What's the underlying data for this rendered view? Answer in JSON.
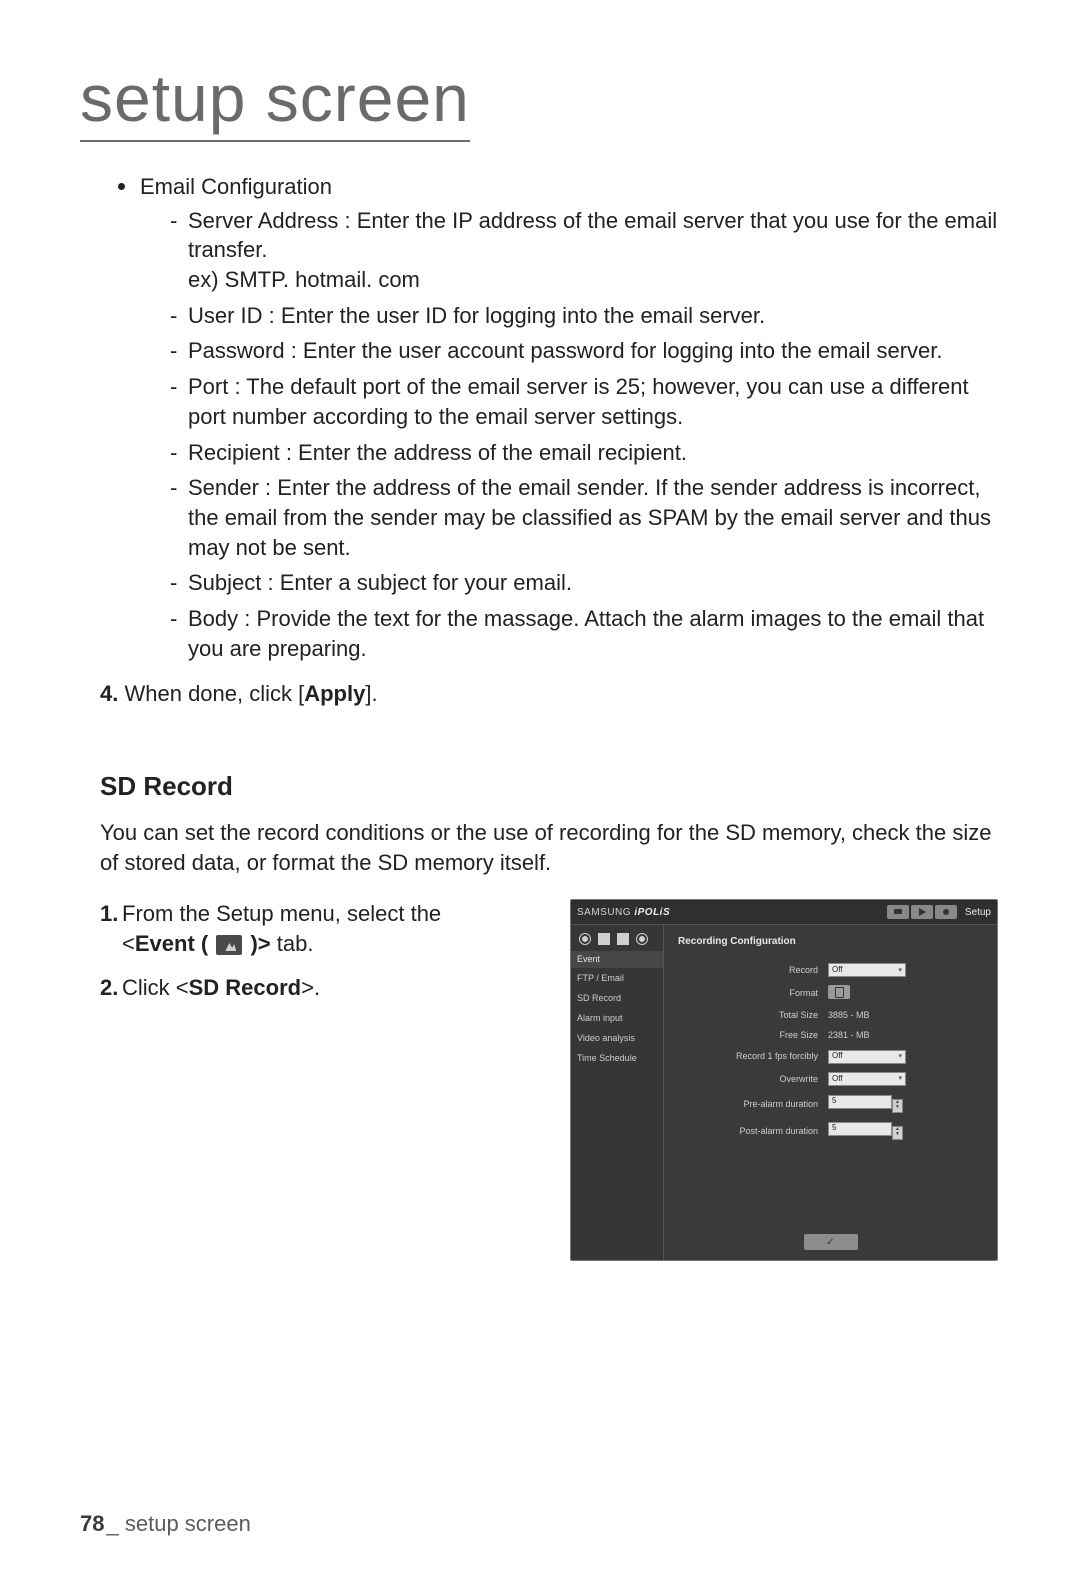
{
  "page": {
    "title": "setup screen",
    "footer_page": "78",
    "footer_sep": "_",
    "footer_label": "setup screen"
  },
  "email_config": {
    "heading": "Email Configuration",
    "items": [
      "Server Address : Enter the IP address of the email server that you use for the email transfer.\nex) SMTP. hotmail. com",
      "User ID : Enter the user ID for logging into the email server.",
      "Password : Enter the user account password for logging into the email server.",
      "Port : The default port of the email server is 25; however, you can use a different port number according to the email server settings.",
      "Recipient : Enter the address of the email recipient.",
      "Sender : Enter the address of the email sender. If the sender address is incorrect, the email from the sender may be classified as SPAM by the email server and thus may not be sent.",
      "Subject : Enter a subject for your email.",
      "Body : Provide the text for the massage. Attach the alarm images to the email that you are preparing."
    ]
  },
  "step4": {
    "num": "4.",
    "text_before": "When done, click [",
    "bold": "Apply",
    "text_after": "]."
  },
  "sd_record": {
    "heading": "SD Record",
    "intro": "You can set the record conditions or the use of recording for the SD memory, check the size of stored data, or format the SD memory itself.",
    "steps": {
      "s1_num": "1.",
      "s1_a": "From the Setup menu, select the",
      "s1_b_open": "<",
      "s1_b_bold": "Event (",
      "s1_b_close": " )>",
      "s1_c": " tab.",
      "s2_num": "2.",
      "s2_a": "Click <",
      "s2_bold": "SD Record",
      "s2_b": ">."
    }
  },
  "screenshot": {
    "brand_a": "SAMSUNG",
    "brand_b": "iPOLiS",
    "setup_label": "Setup",
    "side_event": "Event",
    "side_items": [
      "FTP / Email",
      "SD Record",
      "Alarm input",
      "Video analysis",
      "Time Schedule"
    ],
    "panel_title": "Recording Configuration",
    "rows": {
      "record": {
        "label": "Record",
        "value": "Off"
      },
      "format": {
        "label": "Format"
      },
      "total_size": {
        "label": "Total Size",
        "value": "3885 - MB"
      },
      "free_size": {
        "label": "Free Size",
        "value": "2381 - MB"
      },
      "forcibly": {
        "label": "Record 1 fps forcibly",
        "value": "Off"
      },
      "overwrite": {
        "label": "Overwrite",
        "value": "Off"
      },
      "pre": {
        "label": "Pre-alarm duration",
        "value": "5"
      },
      "post": {
        "label": "Post-alarm duration",
        "value": "5"
      }
    }
  }
}
